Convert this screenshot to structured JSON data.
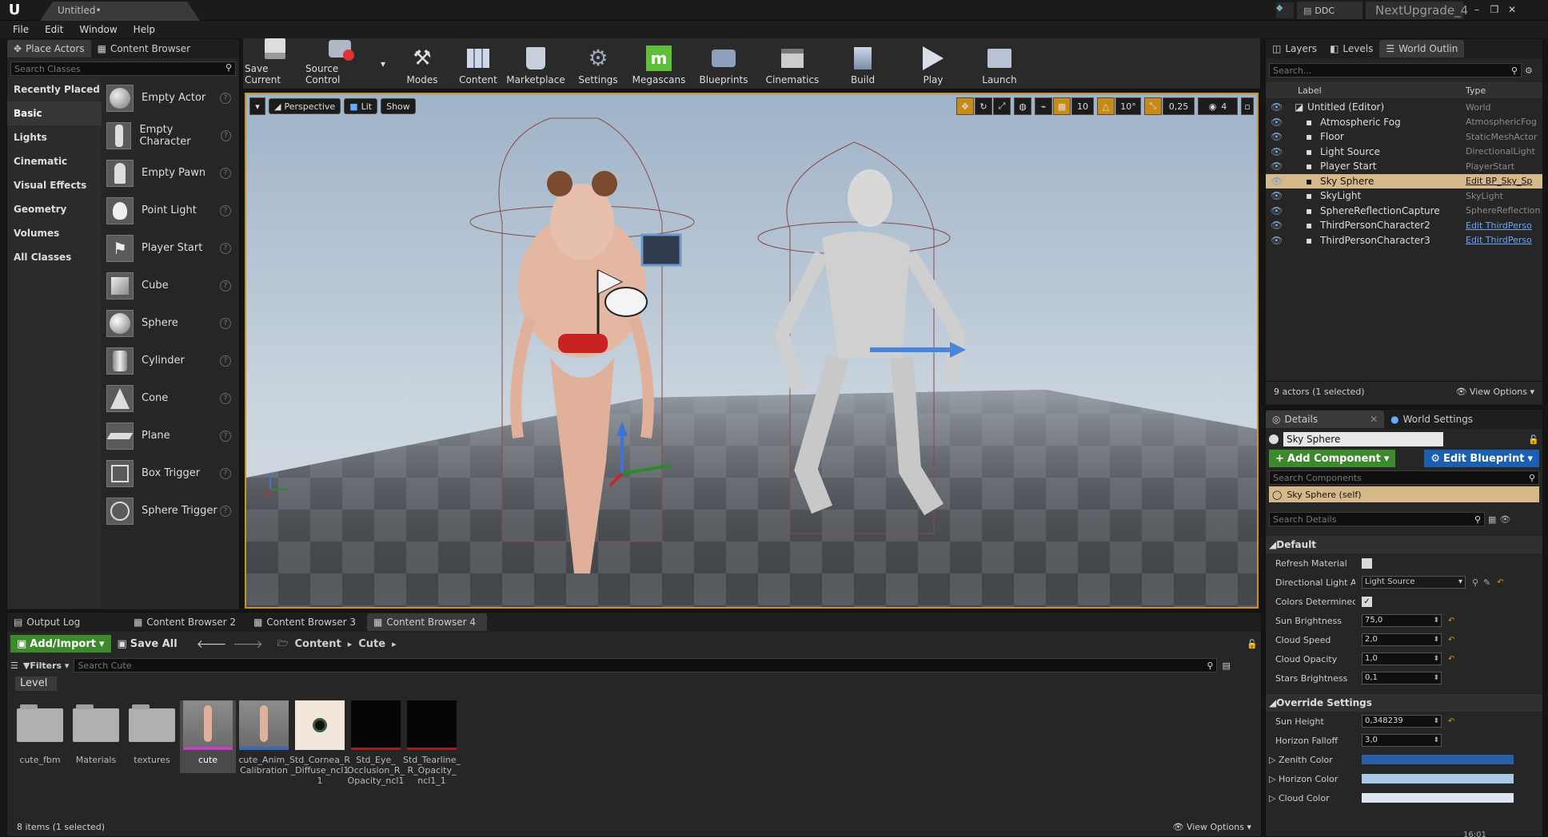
{
  "window": {
    "app_logo": "U",
    "doc_tab": "Untitled•",
    "ddc_label": "DDC",
    "project": "NextUpgrade_4"
  },
  "menu": [
    "File",
    "Edit",
    "Window",
    "Help"
  ],
  "place_actors": {
    "tabs": [
      "Place Actors",
      "Content Browser"
    ],
    "search_placeholder": "Search Classes",
    "categories": [
      "Recently Placed",
      "Basic",
      "Lights",
      "Cinematic",
      "Visual Effects",
      "Geometry",
      "Volumes",
      "All Classes"
    ],
    "actors": [
      "Empty Actor",
      "Empty Character",
      "Empty Pawn",
      "Point Light",
      "Player Start",
      "Cube",
      "Sphere",
      "Cylinder",
      "Cone",
      "Plane",
      "Box Trigger",
      "Sphere Trigger"
    ]
  },
  "toolbar": [
    "Save Current",
    "Source Control",
    "Modes",
    "Content",
    "Marketplace",
    "Settings",
    "Megascans",
    "Blueprints",
    "Cinematics",
    "Build",
    "Play",
    "Launch"
  ],
  "viewport": {
    "perspective": "Perspective",
    "lit": "Lit",
    "show": "Show",
    "grid_snap": "10",
    "rot_snap": "10°",
    "scale_snap": "0,25",
    "cam_speed": "4"
  },
  "outliner": {
    "tabs": [
      "Layers",
      "Levels",
      "World Outlin"
    ],
    "search_placeholder": "Search...",
    "col_label": "Label",
    "col_type": "Type",
    "rows": [
      {
        "label": "Untitled (Editor)",
        "type": "World",
        "link": false
      },
      {
        "label": "Atmospheric Fog",
        "type": "AtmosphericFog",
        "link": false
      },
      {
        "label": "Floor",
        "type": "StaticMeshActor",
        "link": false
      },
      {
        "label": "Light Source",
        "type": "DirectionalLight",
        "link": false
      },
      {
        "label": "Player Start",
        "type": "PlayerStart",
        "link": false
      },
      {
        "label": "Sky Sphere",
        "type": "Edit BP_Sky_Sp",
        "link": true,
        "selected": true
      },
      {
        "label": "SkyLight",
        "type": "SkyLight",
        "link": false
      },
      {
        "label": "SphereReflectionCapture",
        "type": "SphereReflection",
        "link": false
      },
      {
        "label": "ThirdPersonCharacter2",
        "type": "Edit ThirdPerso",
        "link": true
      },
      {
        "label": "ThirdPersonCharacter3",
        "type": "Edit ThirdPerso",
        "link": true
      }
    ],
    "status": "9 actors (1 selected)",
    "view_options": "View Options"
  },
  "details": {
    "tabs": [
      "Details",
      "World Settings"
    ],
    "name": "Sky Sphere",
    "add_component": "Add Component",
    "edit_blueprint": "Edit Blueprint",
    "search_components": "Search Components",
    "self_item": "Sky Sphere (self)",
    "search_details": "Search Details",
    "section_default": "Default",
    "props": [
      {
        "name": "Refresh Material",
        "kind": "check",
        "value": ""
      },
      {
        "name": "Directional Light Ac",
        "kind": "select",
        "value": "Light Source"
      },
      {
        "name": "Colors Determined I",
        "kind": "check",
        "value": "✓"
      },
      {
        "name": "Sun Brightness",
        "kind": "num",
        "value": "75,0"
      },
      {
        "name": "Cloud Speed",
        "kind": "num",
        "value": "2,0"
      },
      {
        "name": "Cloud Opacity",
        "kind": "num",
        "value": "1,0"
      },
      {
        "name": "Stars Brightness",
        "kind": "num",
        "value": "0,1"
      }
    ],
    "section_override": "Override Settings",
    "override_props": [
      {
        "name": "Sun Height",
        "kind": "num",
        "value": "0,348239"
      },
      {
        "name": "Horizon Falloff",
        "kind": "num",
        "value": "3,0"
      },
      {
        "name": "Zenith Color",
        "kind": "color",
        "value": "#2a5fa8"
      },
      {
        "name": "Horizon Color",
        "kind": "color",
        "value": "#a8c8e8"
      },
      {
        "name": "Cloud Color",
        "kind": "color",
        "value": "#dde6f0"
      }
    ],
    "clock": "16:01"
  },
  "bottom": {
    "tabs": [
      "Output Log",
      "Content Browser 2",
      "Content Browser 3",
      "Content Browser 4"
    ],
    "add_import": "Add/Import",
    "save_all": "Save All",
    "path": [
      "Content",
      "Cute"
    ],
    "filters": "Filters",
    "search_placeholder": "Search Cute",
    "filter_chip": "Level",
    "assets": [
      {
        "label": "cute_fbm",
        "kind": "folder"
      },
      {
        "label": "Materials",
        "kind": "folder"
      },
      {
        "label": "textures",
        "kind": "folder"
      },
      {
        "label": "cute",
        "kind": "mesh",
        "selected": true
      },
      {
        "label": "cute_Anim_ Calibration",
        "kind": "anim"
      },
      {
        "label": "Std_Cornea_R _Diffuse_ncl1 1",
        "kind": "eye"
      },
      {
        "label": "Std_Eye_ Occlusion_R_ Opacity_ncl1",
        "kind": "black"
      },
      {
        "label": "Std_Tearline_ R_Opacity_ ncl1_1",
        "kind": "black"
      }
    ],
    "status": "8 items (1 selected)",
    "view_options": "View Options"
  }
}
